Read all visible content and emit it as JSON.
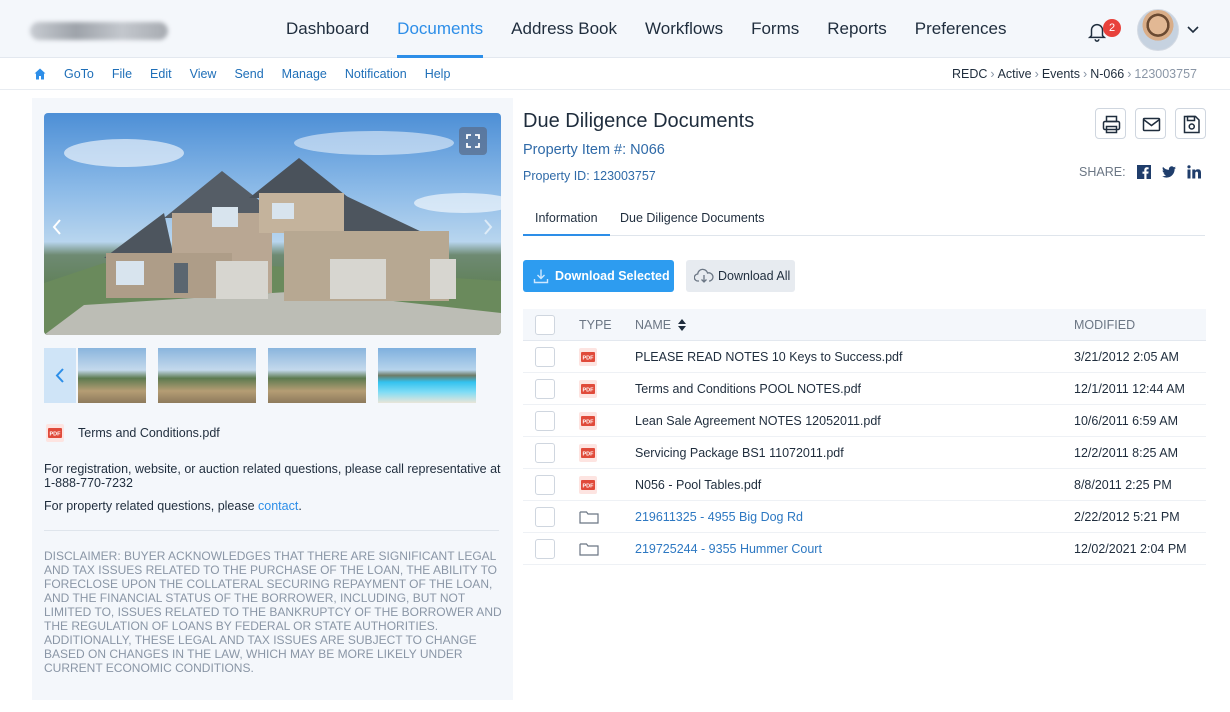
{
  "nav": {
    "items": [
      "Dashboard",
      "Documents",
      "Address Book",
      "Workflows",
      "Forms",
      "Reports",
      "Preferences"
    ],
    "active_index": 1,
    "notification_count": "2"
  },
  "submenu": {
    "items": [
      "GoTo",
      "File",
      "Edit",
      "View",
      "Send",
      "Manage",
      "Notification",
      "Help"
    ]
  },
  "breadcrumb": {
    "items": [
      "REDC",
      "Active",
      "Events",
      "N-066"
    ],
    "current": "123003757"
  },
  "left": {
    "attachment_name": "Terms and Conditions.pdf",
    "registration_text": "For registration, website, or auction related questions, please call representative at 1-888-770-7232",
    "property_text": "For property related questions, please ",
    "contact_link": "contact",
    "property_text_end": ".",
    "disclaimer": "DISCLAIMER: BUYER ACKNOWLEDGES THAT THERE ARE SIGNIFICANT LEGAL AND TAX ISSUES RELATED TO THE PURCHASE OF THE LOAN, THE ABILITY TO FORECLOSE UPON THE COLLATERAL SECURING REPAYMENT OF THE LOAN, AND THE FINANCIAL STATUS OF THE BORROWER, INCLUDING, BUT NOT LIMITED TO, ISSUES RELATED TO THE BANKRUPTCY OF THE BORROWER AND THE REGULATION OF LOANS BY FEDERAL OR STATE AUTHORITIES. ADDITIONALLY, THESE LEGAL AND TAX ISSUES ARE SUBJECT TO CHANGE BASED ON CHANGES IN THE LAW, WHICH MAY BE MORE LIKELY UNDER CURRENT ECONOMIC CONDITIONS."
  },
  "main": {
    "title": "Due Diligence Documents",
    "property_item": "Property Item #: N066",
    "property_id": "Property ID: 123003757",
    "share_label": "SHARE:",
    "tabs": [
      "Information",
      "Due Diligence Documents"
    ],
    "active_tab": 0,
    "download_selected": "Download Selected",
    "download_all": "Download All"
  },
  "table": {
    "headers": {
      "type": "TYPE",
      "name": "NAME",
      "modified": "MODIFIED"
    },
    "rows": [
      {
        "type": "pdf",
        "name": "PLEASE READ NOTES 10 Keys to Success.pdf",
        "modified": "3/21/2012 2:05 AM"
      },
      {
        "type": "pdf",
        "name": "Terms and Conditions POOL NOTES.pdf",
        "modified": "12/1/2011 12:44 AM"
      },
      {
        "type": "pdf",
        "name": "Lean Sale Agreement NOTES 12052011.pdf",
        "modified": "10/6/2011 6:59 AM"
      },
      {
        "type": "pdf",
        "name": "Servicing Package BS1 11072011.pdf",
        "modified": "12/2/2011 8:25 AM"
      },
      {
        "type": "pdf",
        "name": "N056 - Pool Tables.pdf",
        "modified": "8/8/2011 2:25 PM"
      },
      {
        "type": "folder",
        "name": "219611325 - 4955 Big Dog Rd",
        "modified": "2/22/2012 5:21 PM"
      },
      {
        "type": "folder",
        "name": "219725244 - 9355 Hummer Court",
        "modified": "12/02/2021 2:04 PM"
      }
    ]
  },
  "colors": {
    "accent": "#2d8ee8",
    "badge": "#e8413b",
    "pdf": "#e04a3a"
  }
}
